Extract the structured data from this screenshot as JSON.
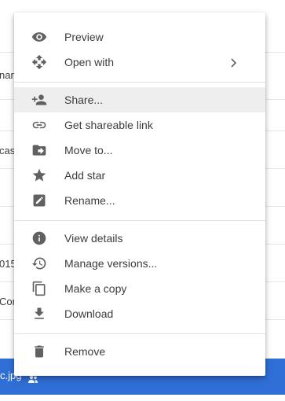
{
  "background": {
    "partial_texts": [
      "nan",
      "cas",
      "015",
      "Cor"
    ],
    "selected_file": "c.jpg",
    "selected_color": "#2f6fd6"
  },
  "menu": {
    "items": [
      {
        "label": "Preview",
        "icon": "eye-icon"
      },
      {
        "label": "Open with",
        "icon": "move-arrows-icon",
        "submenu": "chevron-right-icon"
      },
      {
        "label": "Share...",
        "icon": "person-add-icon"
      },
      {
        "label": "Get shareable link",
        "icon": "link-icon"
      },
      {
        "label": "Move to...",
        "icon": "folder-move-icon"
      },
      {
        "label": "Add star",
        "icon": "star-icon"
      },
      {
        "label": "Rename...",
        "icon": "edit-icon"
      },
      {
        "label": "View details",
        "icon": "info-icon"
      },
      {
        "label": "Manage versions...",
        "icon": "history-icon"
      },
      {
        "label": "Make a copy",
        "icon": "copy-icon"
      },
      {
        "label": "Download",
        "icon": "download-icon"
      },
      {
        "label": "Remove",
        "icon": "trash-icon"
      }
    ]
  }
}
